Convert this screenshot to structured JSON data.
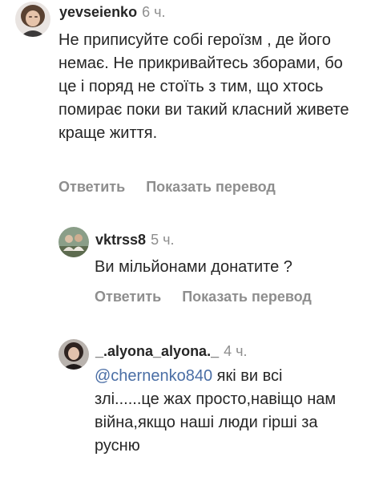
{
  "comments": [
    {
      "username": "yevseienko",
      "time": "6 ч.",
      "text": "Не приписуйте собі героїзм , де його немає. Не прикривайтесь зборами, бо це і поряд не стоїть з тим, що хтось помирає поки ви такий класний живете краще життя.",
      "reply_label": "Ответить",
      "translate_label": "Показать перевод",
      "avatar_icon": "user-avatar-photo"
    },
    {
      "username": "vktrss8",
      "time": "5 ч.",
      "text": "Ви мільйонами донатите ?",
      "reply_label": "Ответить",
      "translate_label": "Показать перевод",
      "avatar_icon": "user-avatar-photo"
    },
    {
      "username": "_.alyona_alyona._",
      "time": "4 ч.",
      "mention": "@chernenko840",
      "text": " які ви всі злі......це жах просто,навіщо нам війна,якщо наші люди гірші за русню",
      "avatar_icon": "user-avatar-photo"
    }
  ],
  "colors": {
    "text": "#262626",
    "secondary": "#8e8e8e",
    "mention": "#4a6ea5",
    "background": "#ffffff"
  }
}
